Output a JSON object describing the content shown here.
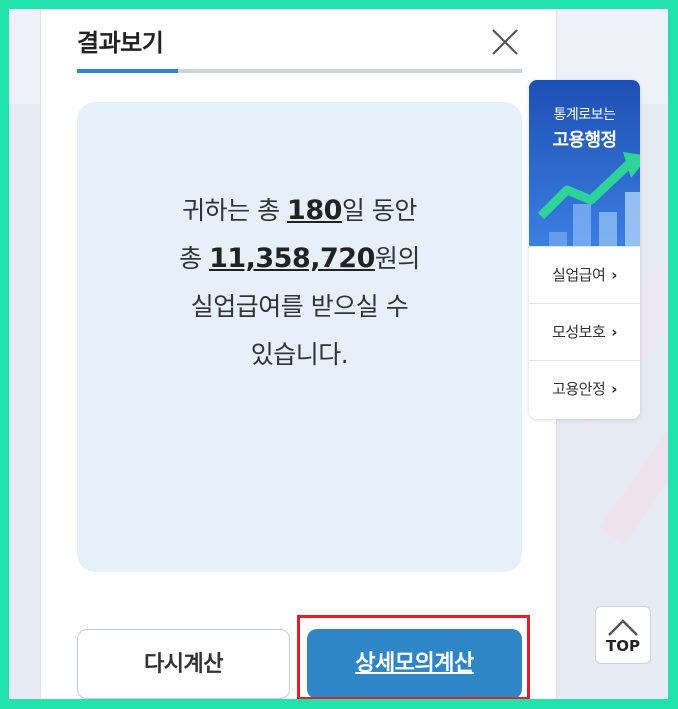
{
  "modal": {
    "title": "결과보기",
    "result": {
      "line1_prefix": "귀하는 총 ",
      "days": "180",
      "line1_suffix": "일 동안",
      "line2_prefix": "총 ",
      "amount": "11,358,720",
      "line2_suffix": "원의",
      "line3": "실업급여를 받으실 수",
      "line4": "있습니다."
    },
    "buttons": {
      "reset_label": "다시계산",
      "detail_label": "상세모의계산"
    }
  },
  "side_widget": {
    "banner_sub": "통계로보는",
    "banner_main": "고용행정",
    "links": [
      "실업급여",
      "모성보호",
      "고용안정"
    ]
  },
  "top_button": {
    "label": "TOP"
  },
  "colors": {
    "accent_blue": "#2f86c6",
    "highlight_red": "#e0202a",
    "frame_green": "#22e3ad",
    "result_bg": "#e6f0fa"
  }
}
